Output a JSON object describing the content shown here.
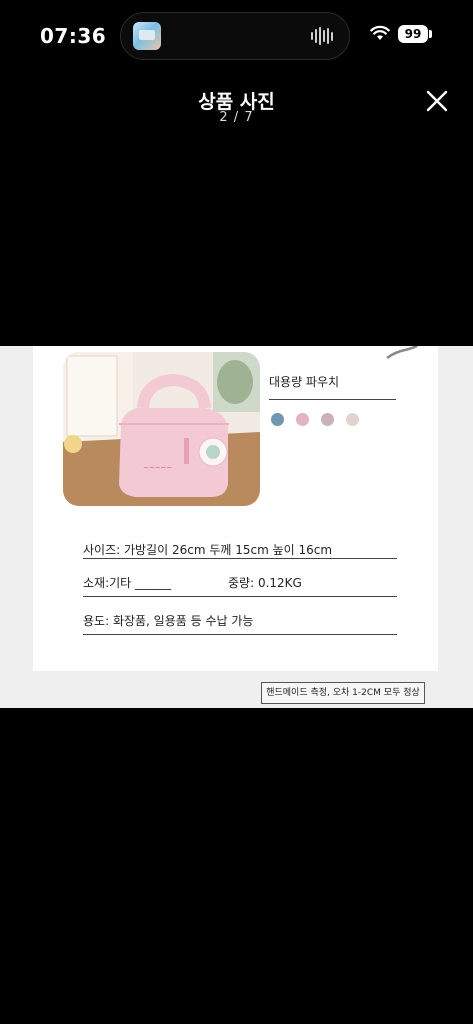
{
  "status_bar": {
    "time": "07:36",
    "battery_level": "99",
    "icons": [
      "app-thumbnail-icon",
      "audio-waveform-icon",
      "wifi-icon",
      "battery-icon"
    ]
  },
  "header": {
    "title": "상품 사진",
    "page_counter": "2 / 7",
    "close_icon": "close-icon"
  },
  "product": {
    "name": "대용량 파우치",
    "color_swatches": [
      "#6f97b1",
      "#e2b3c0",
      "#cbb0bb",
      "#e1d3ce"
    ],
    "specs": {
      "size": "사이즈: 가방길이 26cm 두께 15cm 높이 16cm",
      "material": "소재:기타 ______",
      "weight": "중량: 0.12KG",
      "usage": "용도: 화장품, 일용품 등 수납 가능"
    },
    "note": "핸드메이드 측정, 오차 1-2CM 모두 정상"
  },
  "colors": {
    "background": "#000000",
    "photo_background": "#efefef",
    "card": "#ffffff",
    "product_pink": "#f3c9d3"
  }
}
